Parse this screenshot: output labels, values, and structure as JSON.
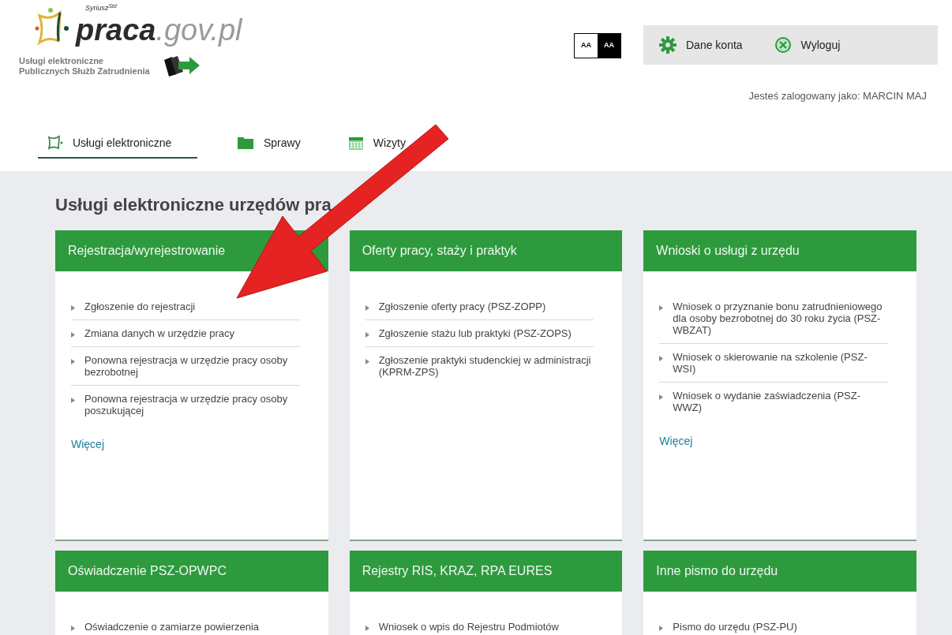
{
  "logo": {
    "superscript": "Syriusz$^{Std}$",
    "name_main": "praca",
    "name_domain": ".gov.pl",
    "subtitle_line1": "Usługi elektroniczne",
    "subtitle_line2": "Publicznych Służb Zatrudnienia"
  },
  "contrast": [
    {
      "label": "AA",
      "selected": false
    },
    {
      "label": "AA",
      "selected": true
    }
  ],
  "account_bar": [
    {
      "kind": "settings",
      "label": "Dane konta"
    },
    {
      "kind": "logout",
      "label": "Wyloguj"
    }
  ],
  "logged_in": "Jesteś zalogowany jako: MARCIN MAJ",
  "tabs": [
    {
      "kind": "services",
      "label": "Usługi elektroniczne",
      "selected": true
    },
    {
      "kind": "folder",
      "label": "Sprawy",
      "selected": false
    },
    {
      "kind": "calendar",
      "label": "Wizyty",
      "selected": false
    }
  ],
  "heading": "Usługi elektroniczne urzędów pra",
  "cards": [
    {
      "title": "Rejestracja/wyrejestrowanie",
      "items": [
        "Zgłoszenie do rejestracji",
        "Zmiana danych w urzędzie pracy",
        "Ponowna rejestracja w urzędzie pracy osoby bezrobotnej",
        "Ponowna rejestracja w urzędzie pracy osoby poszukującej"
      ],
      "more": "Więcej"
    },
    {
      "title": "Oferty pracy, staży i praktyk",
      "items": [
        "Zgłoszenie oferty pracy (PSZ-ZOPP)",
        "Zgłoszenie stażu lub praktyki (PSZ-ZOPS)",
        "Zgłoszenie praktyki studenckiej w administracji (KPRM-ZPS)"
      ]
    },
    {
      "title": "Wnioski o usługi z urzędu",
      "items": [
        "Wniosek o przyznanie bonu zatrudnieniowego dla osoby bezrobotnej do 30 roku życia (PSZ-WBZAT)",
        "Wniosek o skierowanie na szkolenie (PSZ-WSI)",
        "Wniosek o wydanie zaświadczenia (PSZ-WWZ)"
      ],
      "more": "Więcej"
    },
    {
      "title": "Oświadczenie PSZ-OPWPC",
      "items": [
        "Oświadczenie o zamiarze powierzenia"
      ]
    },
    {
      "title": "Rejestry RIS, KRAZ, RPA EURES",
      "items": [
        "Wniosek o wpis do Rejestru Podmiotów"
      ]
    },
    {
      "title": "Inne pismo do urzędu",
      "items": [
        "Pismo do urzędu (PSZ-PU)"
      ]
    }
  ]
}
